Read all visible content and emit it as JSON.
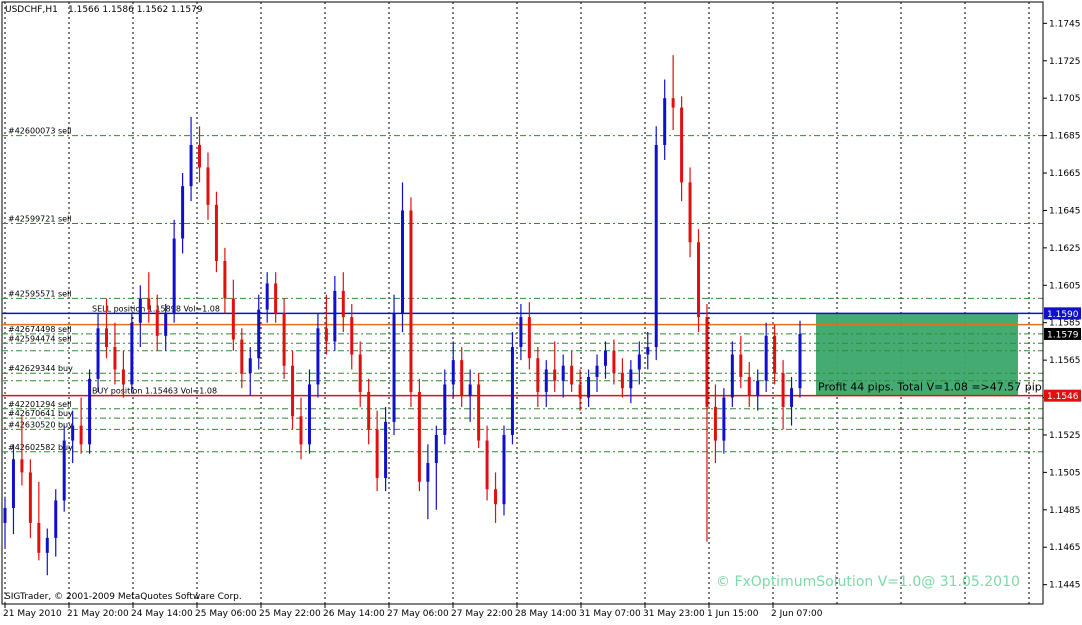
{
  "header": {
    "symbol": "USDCHF,H1",
    "ohlc": "1.1566 1.1586 1.1562 1.1579"
  },
  "footer": {
    "copyright": "SIGTrader, © 2001-2009 MetaQuotes Software Corp.",
    "watermark": "© FxOptimumSolution  V=1.0@ 31.05.2010"
  },
  "chart_data": {
    "type": "candlestick",
    "instrument": "USDCHF",
    "timeframe": "H1",
    "ylim": [
      1.144,
      1.175
    ],
    "price_ticks": [
      "1.1745",
      "1.1725",
      "1.1705",
      "1.1685",
      "1.1665",
      "1.1645",
      "1.1625",
      "1.1605",
      "1.1585",
      "1.1565",
      "1.1545",
      "1.1525",
      "1.1505",
      "1.1485",
      "1.1465",
      "1.1445"
    ],
    "time_labels": [
      "21 May 2010",
      "21 May 20:00",
      "24 May 14:00",
      "25 May 06:00",
      "25 May 22:00",
      "26 May 14:00",
      "27 May 06:00",
      "27 May 22:00",
      "28 May 14:00",
      "31 May 07:00",
      "31 May 23:00",
      "1 Jun 15:00",
      "2 Jun 07:00"
    ],
    "grid": "dotted-vertical",
    "bull_color": "#1010cc",
    "bear_color": "#e01010",
    "candles": [
      {
        "o": 1.1478,
        "h": 1.1492,
        "l": 1.1465,
        "c": 1.1486
      },
      {
        "o": 1.1486,
        "h": 1.152,
        "l": 1.1472,
        "c": 1.1512
      },
      {
        "o": 1.1512,
        "h": 1.1535,
        "l": 1.1498,
        "c": 1.1505
      },
      {
        "o": 1.1505,
        "h": 1.1512,
        "l": 1.147,
        "c": 1.1478
      },
      {
        "o": 1.1478,
        "h": 1.15,
        "l": 1.1458,
        "c": 1.1462
      },
      {
        "o": 1.1462,
        "h": 1.1475,
        "l": 1.145,
        "c": 1.147
      },
      {
        "o": 1.147,
        "h": 1.1496,
        "l": 1.146,
        "c": 1.149
      },
      {
        "o": 1.149,
        "h": 1.153,
        "l": 1.1484,
        "c": 1.1522
      },
      {
        "o": 1.1522,
        "h": 1.1538,
        "l": 1.151,
        "c": 1.153
      },
      {
        "o": 1.153,
        "h": 1.1545,
        "l": 1.1515,
        "c": 1.152
      },
      {
        "o": 1.152,
        "h": 1.156,
        "l": 1.1515,
        "c": 1.1555
      },
      {
        "o": 1.1555,
        "h": 1.159,
        "l": 1.1548,
        "c": 1.1582
      },
      {
        "o": 1.1582,
        "h": 1.1598,
        "l": 1.1566,
        "c": 1.1572
      },
      {
        "o": 1.1572,
        "h": 1.1585,
        "l": 1.1552,
        "c": 1.156
      },
      {
        "o": 1.156,
        "h": 1.157,
        "l": 1.1545,
        "c": 1.1552
      },
      {
        "o": 1.1552,
        "h": 1.159,
        "l": 1.1548,
        "c": 1.1585
      },
      {
        "o": 1.1585,
        "h": 1.1605,
        "l": 1.1572,
        "c": 1.1598
      },
      {
        "o": 1.1598,
        "h": 1.1612,
        "l": 1.1585,
        "c": 1.1592
      },
      {
        "o": 1.1592,
        "h": 1.16,
        "l": 1.157,
        "c": 1.1578
      },
      {
        "o": 1.1578,
        "h": 1.1595,
        "l": 1.157,
        "c": 1.159
      },
      {
        "o": 1.159,
        "h": 1.164,
        "l": 1.1585,
        "c": 1.163
      },
      {
        "o": 1.163,
        "h": 1.1665,
        "l": 1.1622,
        "c": 1.1658
      },
      {
        "o": 1.1658,
        "h": 1.1695,
        "l": 1.165,
        "c": 1.168
      },
      {
        "o": 1.168,
        "h": 1.169,
        "l": 1.166,
        "c": 1.1668
      },
      {
        "o": 1.1668,
        "h": 1.1676,
        "l": 1.164,
        "c": 1.1648
      },
      {
        "o": 1.1648,
        "h": 1.1655,
        "l": 1.1612,
        "c": 1.1618
      },
      {
        "o": 1.1618,
        "h": 1.1625,
        "l": 1.159,
        "c": 1.1598
      },
      {
        "o": 1.1598,
        "h": 1.1608,
        "l": 1.157,
        "c": 1.1576
      },
      {
        "o": 1.1576,
        "h": 1.1582,
        "l": 1.155,
        "c": 1.1558
      },
      {
        "o": 1.1558,
        "h": 1.1572,
        "l": 1.1546,
        "c": 1.1566
      },
      {
        "o": 1.1566,
        "h": 1.16,
        "l": 1.156,
        "c": 1.1592
      },
      {
        "o": 1.1592,
        "h": 1.1612,
        "l": 1.1585,
        "c": 1.1606
      },
      {
        "o": 1.1606,
        "h": 1.1612,
        "l": 1.1585,
        "c": 1.159
      },
      {
        "o": 1.159,
        "h": 1.1598,
        "l": 1.1555,
        "c": 1.1562
      },
      {
        "o": 1.1562,
        "h": 1.157,
        "l": 1.1528,
        "c": 1.1535
      },
      {
        "o": 1.1535,
        "h": 1.1545,
        "l": 1.1512,
        "c": 1.152
      },
      {
        "o": 1.152,
        "h": 1.156,
        "l": 1.1515,
        "c": 1.1552
      },
      {
        "o": 1.1552,
        "h": 1.159,
        "l": 1.1545,
        "c": 1.1582
      },
      {
        "o": 1.1582,
        "h": 1.16,
        "l": 1.1568,
        "c": 1.1575
      },
      {
        "o": 1.1575,
        "h": 1.161,
        "l": 1.157,
        "c": 1.1602
      },
      {
        "o": 1.1602,
        "h": 1.1612,
        "l": 1.158,
        "c": 1.1588
      },
      {
        "o": 1.1588,
        "h": 1.1595,
        "l": 1.156,
        "c": 1.1568
      },
      {
        "o": 1.1568,
        "h": 1.1575,
        "l": 1.154,
        "c": 1.1548
      },
      {
        "o": 1.1548,
        "h": 1.1555,
        "l": 1.152,
        "c": 1.1528
      },
      {
        "o": 1.1528,
        "h": 1.1538,
        "l": 1.1495,
        "c": 1.1502
      },
      {
        "o": 1.1502,
        "h": 1.154,
        "l": 1.1495,
        "c": 1.1532
      },
      {
        "o": 1.1532,
        "h": 1.16,
        "l": 1.1525,
        "c": 1.159
      },
      {
        "o": 1.159,
        "h": 1.166,
        "l": 1.158,
        "c": 1.1645
      },
      {
        "o": 1.1645,
        "h": 1.1652,
        "l": 1.154,
        "c": 1.1548
      },
      {
        "o": 1.1548,
        "h": 1.1555,
        "l": 1.1495,
        "c": 1.15
      },
      {
        "o": 1.15,
        "h": 1.152,
        "l": 1.148,
        "c": 1.151
      },
      {
        "o": 1.151,
        "h": 1.153,
        "l": 1.1485,
        "c": 1.1525
      },
      {
        "o": 1.1525,
        "h": 1.156,
        "l": 1.152,
        "c": 1.1552
      },
      {
        "o": 1.1552,
        "h": 1.1575,
        "l": 1.1545,
        "c": 1.1565
      },
      {
        "o": 1.1565,
        "h": 1.1572,
        "l": 1.154,
        "c": 1.1546
      },
      {
        "o": 1.1546,
        "h": 1.156,
        "l": 1.1532,
        "c": 1.1552
      },
      {
        "o": 1.1552,
        "h": 1.1558,
        "l": 1.1518,
        "c": 1.1522
      },
      {
        "o": 1.1522,
        "h": 1.153,
        "l": 1.149,
        "c": 1.1496
      },
      {
        "o": 1.1496,
        "h": 1.1505,
        "l": 1.1478,
        "c": 1.1488
      },
      {
        "o": 1.1488,
        "h": 1.153,
        "l": 1.1482,
        "c": 1.1525
      },
      {
        "o": 1.1525,
        "h": 1.158,
        "l": 1.152,
        "c": 1.1572
      },
      {
        "o": 1.1572,
        "h": 1.1595,
        "l": 1.1565,
        "c": 1.1588
      },
      {
        "o": 1.1588,
        "h": 1.1596,
        "l": 1.156,
        "c": 1.1566
      },
      {
        "o": 1.1566,
        "h": 1.1572,
        "l": 1.154,
        "c": 1.1548
      },
      {
        "o": 1.1548,
        "h": 1.1565,
        "l": 1.154,
        "c": 1.156
      },
      {
        "o": 1.156,
        "h": 1.1575,
        "l": 1.1548,
        "c": 1.1554
      },
      {
        "o": 1.1554,
        "h": 1.1568,
        "l": 1.1545,
        "c": 1.1562
      },
      {
        "o": 1.1562,
        "h": 1.157,
        "l": 1.1548,
        "c": 1.1552
      },
      {
        "o": 1.1552,
        "h": 1.156,
        "l": 1.1538,
        "c": 1.1545
      },
      {
        "o": 1.1545,
        "h": 1.156,
        "l": 1.154,
        "c": 1.1556
      },
      {
        "o": 1.1556,
        "h": 1.1568,
        "l": 1.1548,
        "c": 1.1562
      },
      {
        "o": 1.1562,
        "h": 1.1575,
        "l": 1.1555,
        "c": 1.157
      },
      {
        "o": 1.157,
        "h": 1.1576,
        "l": 1.1552,
        "c": 1.1558
      },
      {
        "o": 1.1558,
        "h": 1.1566,
        "l": 1.1545,
        "c": 1.155
      },
      {
        "o": 1.155,
        "h": 1.1565,
        "l": 1.1542,
        "c": 1.156
      },
      {
        "o": 1.156,
        "h": 1.1575,
        "l": 1.1552,
        "c": 1.1568
      },
      {
        "o": 1.1568,
        "h": 1.158,
        "l": 1.156,
        "c": 1.1572
      },
      {
        "o": 1.1572,
        "h": 1.169,
        "l": 1.1565,
        "c": 1.168
      },
      {
        "o": 1.168,
        "h": 1.1715,
        "l": 1.1672,
        "c": 1.1705
      },
      {
        "o": 1.1705,
        "h": 1.1728,
        "l": 1.1688,
        "c": 1.17
      },
      {
        "o": 1.17,
        "h": 1.1706,
        "l": 1.165,
        "c": 1.166
      },
      {
        "o": 1.166,
        "h": 1.1668,
        "l": 1.162,
        "c": 1.1628
      },
      {
        "o": 1.1628,
        "h": 1.1635,
        "l": 1.158,
        "c": 1.1588
      },
      {
        "o": 1.1588,
        "h": 1.1595,
        "l": 1.1468,
        "c": 1.154
      },
      {
        "o": 1.154,
        "h": 1.1552,
        "l": 1.151,
        "c": 1.1522
      },
      {
        "o": 1.1522,
        "h": 1.155,
        "l": 1.1515,
        "c": 1.1545
      },
      {
        "o": 1.1545,
        "h": 1.1575,
        "l": 1.154,
        "c": 1.1568
      },
      {
        "o": 1.1568,
        "h": 1.1578,
        "l": 1.155,
        "c": 1.1556
      },
      {
        "o": 1.1556,
        "h": 1.1564,
        "l": 1.154,
        "c": 1.1546
      },
      {
        "o": 1.1546,
        "h": 1.156,
        "l": 1.1538,
        "c": 1.1554
      },
      {
        "o": 1.1554,
        "h": 1.1585,
        "l": 1.1548,
        "c": 1.1578
      },
      {
        "o": 1.1578,
        "h": 1.1584,
        "l": 1.1552,
        "c": 1.1558
      },
      {
        "o": 1.1558,
        "h": 1.1565,
        "l": 1.1528,
        "c": 1.154
      },
      {
        "o": 1.154,
        "h": 1.1556,
        "l": 1.153,
        "c": 1.155
      },
      {
        "o": 1.155,
        "h": 1.1586,
        "l": 1.1545,
        "c": 1.1579
      }
    ],
    "horizontal_lines": [
      {
        "price": 1.1685,
        "label": "#42600073 sell",
        "color": "#2e8b2e",
        "style": "dashdot"
      },
      {
        "price": 1.1638,
        "label": "#42599721 sell",
        "color": "#2e8b2e",
        "style": "dashdot"
      },
      {
        "price": 1.1598,
        "label": "#42595571 sell",
        "color": "#2e8b2e",
        "style": "dashdot"
      },
      {
        "price": 1.159,
        "label": "SELL position 1.15898  Vol=1.08",
        "color": "#1010cc",
        "style": "solid"
      },
      {
        "price": 1.1584,
        "label": "",
        "color": "#e07020",
        "style": "solid"
      },
      {
        "price": 1.1579,
        "label": "#42674498 sell",
        "color": "#2e8b2e",
        "style": "dashdot"
      },
      {
        "price": 1.1574,
        "label": "#42594474 sell",
        "color": "#2e8b2e",
        "style": "dashdot"
      },
      {
        "price": 1.157,
        "label": "",
        "color": "#2e8b2e",
        "style": "dashdot"
      },
      {
        "price": 1.1558,
        "label": "#42629344 buy",
        "color": "#2e8b2e",
        "style": "dashdot"
      },
      {
        "price": 1.1554,
        "label": "",
        "color": "#2e8b2e",
        "style": "dashdot"
      },
      {
        "price": 1.1546,
        "label": "BUY position 1.15463  Vol=1.08",
        "color": "#e01010",
        "style": "solid"
      },
      {
        "price": 1.1539,
        "label": "#42201294 sell",
        "color": "#2e8b2e",
        "style": "dashdot"
      },
      {
        "price": 1.1534,
        "label": "#42670641 buy",
        "color": "#2e8b2e",
        "style": "dashdot"
      },
      {
        "price": 1.1528,
        "label": "#42630520 buy",
        "color": "#2e8b2e",
        "style": "dashdot"
      },
      {
        "price": 1.1516,
        "label": "#42602582 buy",
        "color": "#2e8b2e",
        "style": "dashdot"
      }
    ],
    "price_tags": [
      {
        "price": 1.159,
        "text": "1.1590",
        "bg": "#1010cc"
      },
      {
        "price": 1.1579,
        "text": "1.1579",
        "bg": "#000000"
      },
      {
        "price": 1.1546,
        "text": "1.1546",
        "bg": "#e01010"
      }
    ],
    "profit_box": {
      "top_price": 1.159,
      "bottom_price": 1.1546,
      "text": "Profit 44 pips. Total V=1.08 =>47.57 pip",
      "color": "#3aa86a"
    }
  }
}
